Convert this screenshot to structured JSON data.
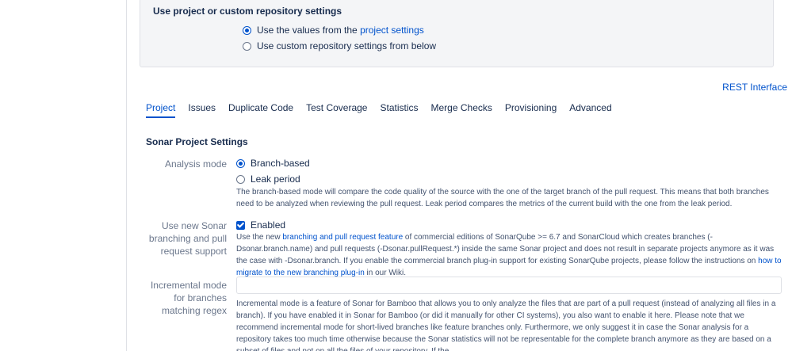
{
  "repo_settings": {
    "title": "Use project or custom repository settings",
    "option_project_prefix": "Use the values from the ",
    "option_project_link": "project settings",
    "option_custom": "Use custom repository settings from below"
  },
  "rest_interface": "REST Interface",
  "tabs": [
    {
      "label": "Project"
    },
    {
      "label": "Issues"
    },
    {
      "label": "Duplicate Code"
    },
    {
      "label": "Test Coverage"
    },
    {
      "label": "Statistics"
    },
    {
      "label": "Merge Checks"
    },
    {
      "label": "Provisioning"
    },
    {
      "label": "Advanced"
    }
  ],
  "section_title": "Sonar Project Settings",
  "analysis_mode": {
    "label": "Analysis mode",
    "option_branch": "Branch-based",
    "option_leak": "Leak period",
    "description": "The branch-based mode will compare the code quality of the source with the one of the target branch of the pull request. This means that both branches need to be analyzed when reviewing the pull request. Leak period compares the metrics of the current build with the one from the leak period."
  },
  "sonar_branching": {
    "label": "Use new Sonar branching and pull request support",
    "checkbox_label": "Enabled",
    "desc_part1": "Use the new ",
    "desc_link1": "branching and pull request feature",
    "desc_part2": " of commercial editions of SonarQube >= 6.7 and SonarCloud which creates branches (-Dsonar.branch.name) and pull requests (-Dsonar.pullRequest.*) inside the same Sonar project and does not result in separate projects anymore as it was the case with -Dsonar.branch. If you enable the commercial branch plug-in support for existing SonarQube projects, please follow the instructions on ",
    "desc_link2": "how to migrate to the new branching plug-in",
    "desc_part3": " in our Wiki."
  },
  "incremental": {
    "label": "Incremental mode for branches matching regex",
    "input_value": "",
    "description": "Incremental mode is a feature of Sonar for Bamboo that allows you to only analyze the files that are part of a pull request (instead of analyzing all files in a branch). If you have enabled it in Sonar for Bamboo (or did it manually for other CI systems), you also want to enable it here. Please note that we recommend incremental mode for short-lived branches like feature branches only. Furthermore, we only suggest it in case the Sonar analysis for a repository takes too much time otherwise because the Sonar statistics will not be representable for the complete branch anymore as they are based on a subset of files and not on all the files of your repository. If the"
  },
  "colors": {
    "accent": "#0052cc",
    "text": "#172b4d",
    "muted": "#6b778c",
    "panel_bg": "#f4f5f7",
    "border": "#dfe1e6"
  }
}
